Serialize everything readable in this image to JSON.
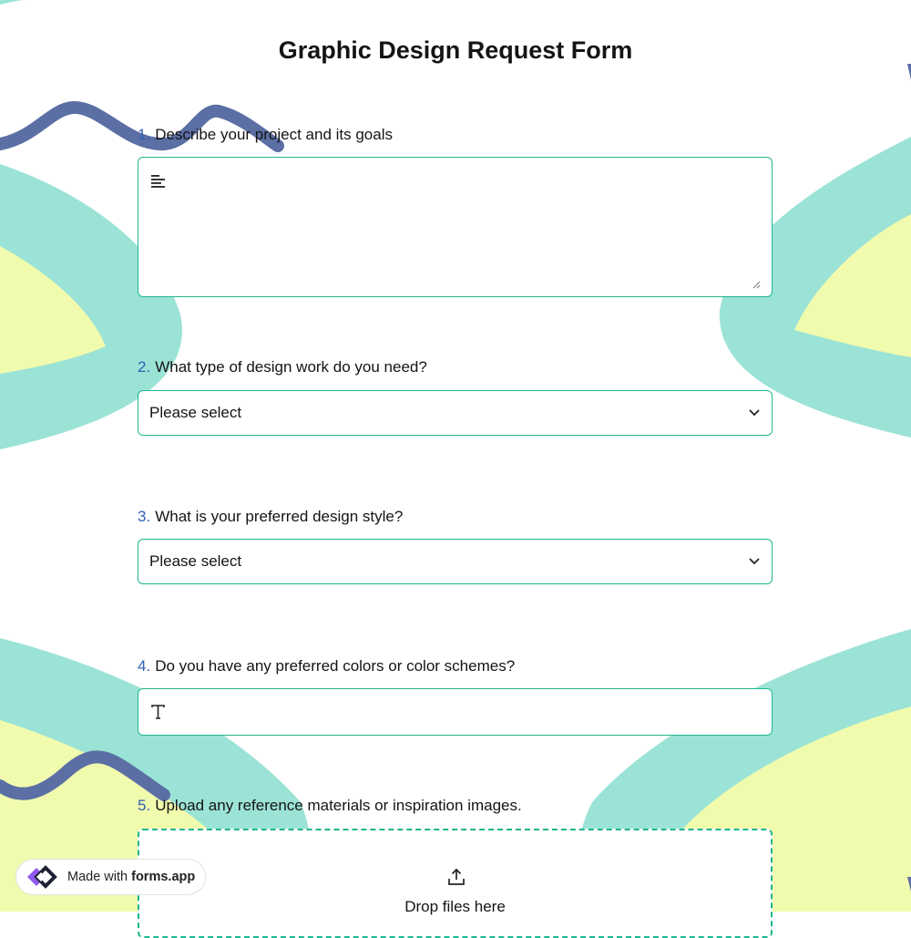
{
  "form": {
    "title": "Graphic Design Request Form",
    "accent_color": "#1fb58f",
    "number_color": "#2f5fb3",
    "questions": [
      {
        "number": "1.",
        "label": "Describe your project and its goals",
        "type": "textarea",
        "icon": "text-align-icon"
      },
      {
        "number": "2.",
        "label": "What type of design work do you need?",
        "type": "select",
        "value": "Please select"
      },
      {
        "number": "3.",
        "label": "What is your preferred design style?",
        "type": "select",
        "value": "Please select"
      },
      {
        "number": "4.",
        "label": "Do you have any preferred colors or color schemes?",
        "type": "text",
        "icon": "text-t-icon"
      },
      {
        "number": "5.",
        "label": "Upload any reference materials or inspiration images.",
        "type": "file",
        "drop_text": "Drop files here",
        "icon": "upload-icon"
      }
    ]
  },
  "badge": {
    "prefix": "Made with ",
    "brand": "forms.app",
    "icon": "forms-app-logo"
  },
  "background": {
    "teal": "#9be3d6",
    "yellow": "#f1fbae",
    "navy": "#5b6fa5"
  }
}
